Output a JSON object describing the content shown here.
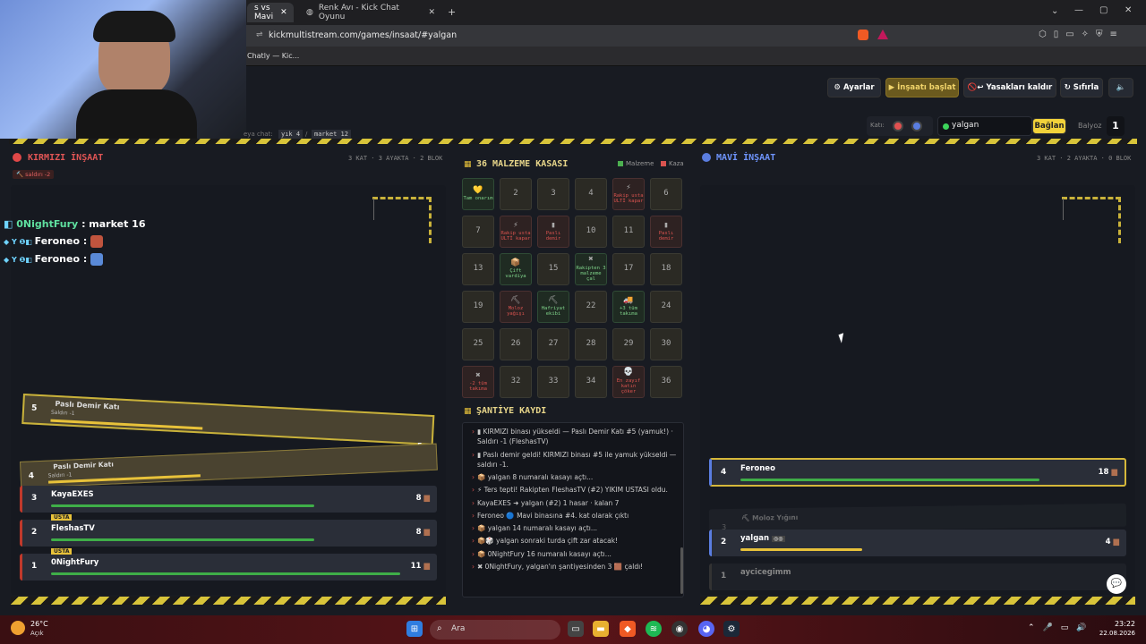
{
  "browser": {
    "tabs": [
      "s vs Mavi",
      "Renk Avı - Kick Chat Oyunu"
    ],
    "url": "kickmultistream.com/games/insaat/#yalgan",
    "bookmark": "Chatly — Kic..."
  },
  "toolbar": {
    "settings": "Ayarlar",
    "start": "▶ İnşaatı başlat",
    "remove_bans": "🚫↩ Yasakları kaldır",
    "reset": "↻ Sıfırla",
    "kati_label": "Katı:",
    "channel": "yalgan",
    "connect": "Bağlan",
    "balyoz_label": "Balyoz",
    "balyoz_value": "1",
    "chat_hint": "eya chat:",
    "cmd1": "yık 4",
    "cmd_sep": "/",
    "cmd2": "market 12"
  },
  "red": {
    "title": "KIRMIZI İNŞAAT",
    "stats": "3 KAT · 3 AYAKTA · 2 BLOK",
    "attack": "🔨 saldırı -2",
    "floors": [
      {
        "num": "5",
        "name": "Paslı Demir Katı",
        "sub": "Saldırı -1",
        "score": "5"
      },
      {
        "num": "4",
        "name": "Paslı Demir Katı",
        "sub": "Saldırı -1",
        "score": ""
      }
    ],
    "rows": [
      {
        "num": "3",
        "name": "KayaEXES",
        "score": "8",
        "fill": 0.55,
        "badge": ""
      },
      {
        "num": "2",
        "name": "FleshasTV",
        "score": "8",
        "fill": 0.55,
        "badge": "USTA"
      },
      {
        "num": "1",
        "name": "0NightFury",
        "score": "11",
        "fill": 0.7,
        "badge": "USTA"
      }
    ]
  },
  "chat": [
    {
      "user": "0NightFury",
      "msg": "market 16"
    },
    {
      "user": "Feroneo",
      "msg": ""
    },
    {
      "user": "Feroneo",
      "msg": ""
    }
  ],
  "box": {
    "title": "36 MALZEME KASASI",
    "legend_mat": "Malzeme",
    "legend_acc": "Kaza",
    "cells": [
      {
        "t": "💛",
        "l": "Tam onarım",
        "k": "green"
      },
      {
        "t": "2"
      },
      {
        "t": "3"
      },
      {
        "t": "4"
      },
      {
        "t": "⚡",
        "l": "Rakip usta ULTİ kapar",
        "k": "red"
      },
      {
        "t": "6"
      },
      {
        "t": "7"
      },
      {
        "t": "⚡",
        "l": "Rakip usta ULTİ kapar",
        "k": "red"
      },
      {
        "t": "▮",
        "l": "Paslı demir",
        "k": "red"
      },
      {
        "t": "10"
      },
      {
        "t": "11"
      },
      {
        "t": "▮",
        "l": "Paslı demir",
        "k": "red"
      },
      {
        "t": "13"
      },
      {
        "t": "📦",
        "l": "Çift vardiya",
        "k": "green"
      },
      {
        "t": "15"
      },
      {
        "t": "✖",
        "l": "Rakipten 3 malzeme çal",
        "k": "green"
      },
      {
        "t": "17"
      },
      {
        "t": "18"
      },
      {
        "t": "19"
      },
      {
        "t": "⛏",
        "l": "Moloz yağışı",
        "k": "red"
      },
      {
        "t": "⛏",
        "l": "Hafriyat ekibi",
        "k": "green"
      },
      {
        "t": "22"
      },
      {
        "t": "🚚",
        "l": "+3 tüm takıma",
        "k": "green"
      },
      {
        "t": "24"
      },
      {
        "t": "25"
      },
      {
        "t": "26"
      },
      {
        "t": "27"
      },
      {
        "t": "28"
      },
      {
        "t": "29"
      },
      {
        "t": "30"
      },
      {
        "t": "✖",
        "l": "-2 tüm takıma",
        "k": "red"
      },
      {
        "t": "32"
      },
      {
        "t": "33"
      },
      {
        "t": "34"
      },
      {
        "t": "💀",
        "l": "En zayıf katın çöker",
        "k": "red"
      },
      {
        "t": "36"
      }
    ]
  },
  "log": {
    "title": "ŞANTİYE KAYDI",
    "lines": [
      "▮ KIRMIZI binası yükseldi — Paslı Demir Katı #5 (yamuk!) · Saldırı -1 (FleshasTV)",
      "▮ Paslı demir geldi! KIRMIZI binası #5 ile yamuk yükseldi — saldırı -1.",
      "📦 yalgan 8 numaralı kasayı açtı...",
      "⚡ Ters tepti! Rakipten FleshasTV (#2) YIKIM USTASI oldu.",
      "KayaEXES ➜ yalgan (#2) 1 hasar · kalan 7",
      "Feroneo 🔵 Mavi binasına #4. kat olarak çıktı",
      "📦 yalgan 14 numaralı kasayı açtı...",
      "📦🎲 yalgan sonraki turda çift zar atacak!",
      "📦 0NightFury 16 numaralı kasayı açtı...",
      "✖ 0NightFury, yalgan'ın şantiyesinden 3 🟫 çaldı!"
    ]
  },
  "blue": {
    "title": "MAVİ İNŞAAT",
    "stats": "3 KAT · 2 AYAKTA · 0 BLOK",
    "rows": [
      {
        "num": "4",
        "name": "Feroneo",
        "score": "18",
        "fill": 0.85
      },
      {
        "num": "3",
        "name": "Moloz Yığını",
        "score": "",
        "fill": 0
      },
      {
        "num": "2",
        "name": "yalgan",
        "score": "4",
        "fill": 0.3
      },
      {
        "num": "1",
        "name": "aycicegimm",
        "score": "",
        "fill": 0
      }
    ]
  },
  "taskbar": {
    "weather": "26°C",
    "weather_sub": "Açık",
    "search": "Ara",
    "time": "23:22",
    "date": "22.08.2026"
  }
}
